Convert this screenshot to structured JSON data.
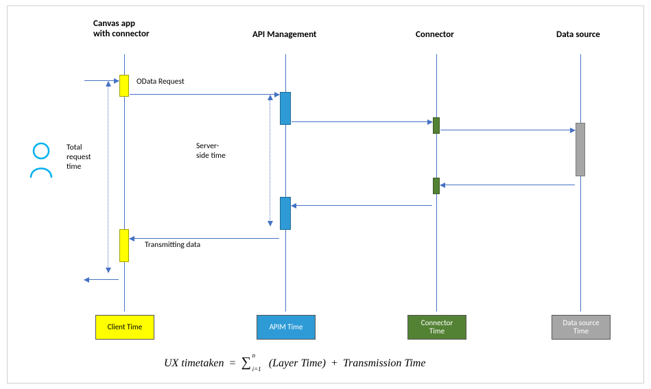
{
  "lanes": {
    "canvas": "Canvas app\nwith connector",
    "apim": "API Management",
    "connector": "Connector",
    "datasource": "Data source"
  },
  "labels": {
    "odata": "OData Request",
    "transmitting": "Transmitting data",
    "total_request": "Total\nrequest\ntime",
    "server_side": "Server-\nside time"
  },
  "time_boxes": {
    "client": "Client Time",
    "apim": "APIM Time",
    "connector": "Connector\nTime",
    "datasource": "Data source\nTime"
  },
  "formula": {
    "lhs": "UX timetaken",
    "eq": "=",
    "sum": "∑",
    "sup": "n",
    "sub": "i=1",
    "term1": "(Layer Time)",
    "plus": "+",
    "term2": "Transmission Time"
  },
  "chart_data": {
    "type": "sequence-diagram",
    "participants": [
      {
        "id": "user",
        "name": "User"
      },
      {
        "id": "canvas",
        "name": "Canvas app with connector"
      },
      {
        "id": "apim",
        "name": "API Management"
      },
      {
        "id": "connector",
        "name": "Connector"
      },
      {
        "id": "datasource",
        "name": "Data source"
      }
    ],
    "messages": [
      {
        "from": "user",
        "to": "canvas",
        "label": ""
      },
      {
        "from": "canvas",
        "to": "apim",
        "label": "OData Request"
      },
      {
        "from": "apim",
        "to": "connector",
        "label": ""
      },
      {
        "from": "connector",
        "to": "datasource",
        "label": ""
      },
      {
        "from": "datasource",
        "to": "connector",
        "label": ""
      },
      {
        "from": "connector",
        "to": "apim",
        "label": ""
      },
      {
        "from": "apim",
        "to": "canvas",
        "label": "Transmitting data"
      },
      {
        "from": "canvas",
        "to": "user",
        "label": ""
      }
    ],
    "spans": [
      {
        "on": "canvas",
        "label": "Total request time"
      },
      {
        "on": "apim",
        "label": "Server-side time"
      }
    ],
    "time_layers": [
      "Client Time",
      "APIM Time",
      "Connector Time",
      "Data source Time"
    ],
    "equation": "UX timetaken = Σ_{i=1}^{n} (Layer Time) + Transmission Time"
  }
}
